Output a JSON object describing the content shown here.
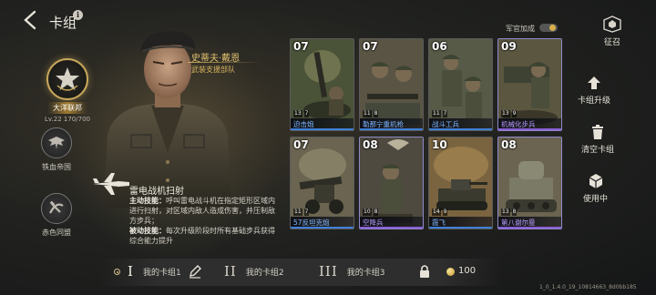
{
  "header": {
    "title": "卡组",
    "info": "i"
  },
  "factions": [
    {
      "name": "大洋联邦",
      "level": "Lv.22",
      "progress": "170/700",
      "selected": true
    },
    {
      "name": "铁血帝国",
      "selected": false
    },
    {
      "name": "赤色同盟",
      "selected": false
    }
  ],
  "commander": {
    "name": "史蒂夫·戴恩",
    "unit": "武装支援部队",
    "skill_name": "雷电战机扫射",
    "main_skill_label": "主动技能：",
    "main_skill_text": "呼叫雷电战斗机在指定矩形区域内进行扫射，对区域内敌人造成伤害，并压制敌方步兵；",
    "passive_skill_label": "被动技能：",
    "passive_skill_text": "每次升级阶段时所有基础步兵获得综合能力提升"
  },
  "cards": [
    {
      "cost": "07",
      "name": "迫击炮",
      "stat1": "13",
      "stat2": "7",
      "bar": "#3f7fd6"
    },
    {
      "cost": "07",
      "name": "勒那宁重机枪",
      "stat1": "11",
      "stat2": "8",
      "bar": "#3f7fd6"
    },
    {
      "cost": "06",
      "name": "战斗工兵",
      "stat1": "11",
      "stat2": "7",
      "bar": "#3f7fd6"
    },
    {
      "cost": "09",
      "name": "机械化步兵",
      "stat1": "13",
      "stat2": "9",
      "bar": "#8a5fd6"
    },
    {
      "cost": "07",
      "name": "57反坦克炮",
      "stat1": "11",
      "stat2": "7",
      "bar": "#3f7fd6"
    },
    {
      "cost": "08",
      "name": "空降兵",
      "stat1": "10",
      "stat2": "8",
      "bar": "#8a5fd6"
    },
    {
      "cost": "10",
      "name": "霞飞",
      "stat1": "14",
      "stat2": "9",
      "bar": "#3f7fd6"
    },
    {
      "cost": "08",
      "name": "第八谢尔曼",
      "stat1": "13",
      "stat2": "8",
      "bar": "#8a5fd6"
    }
  ],
  "right_panel": {
    "officer_bonus": "军官加成",
    "summon": "征召",
    "upgrade": "卡组升级",
    "clear": "清空卡组",
    "in_use": "使用中"
  },
  "deck_tabs": [
    {
      "numeral": "I",
      "label": "我的卡组1",
      "active": true
    },
    {
      "numeral": "II",
      "label": "我的卡组2",
      "active": false
    },
    {
      "numeral": "III",
      "label": "我的卡组3",
      "active": false
    }
  ],
  "unlock_cost": "100",
  "version": "1_0_1.4.0_19_10814663_8d0bb185",
  "colors": {
    "accent_gold": "#c8a85a",
    "blue_rarity": "#3f7fd6",
    "purple_rarity": "#8a5fd6"
  }
}
